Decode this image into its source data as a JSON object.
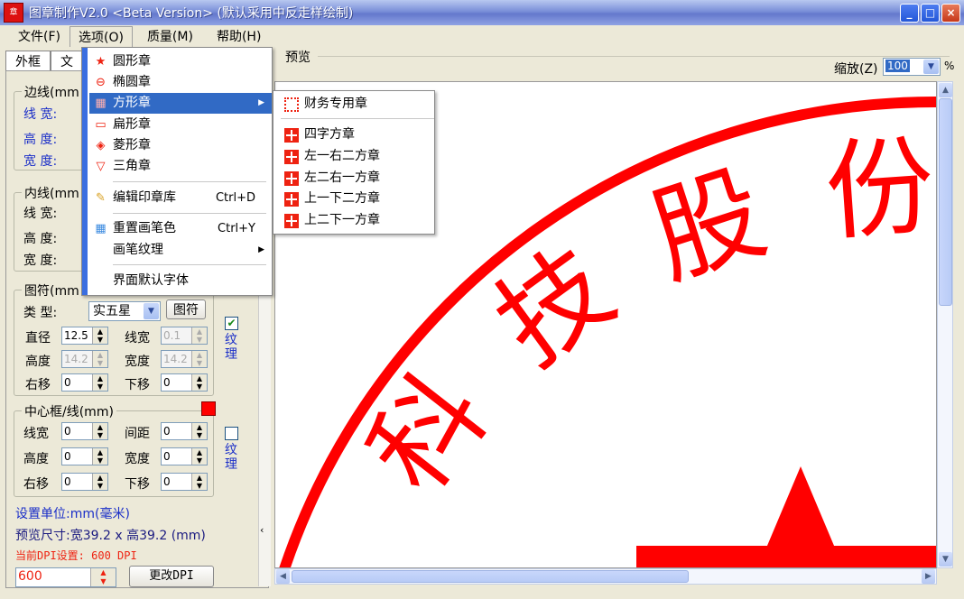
{
  "window": {
    "title": "图章制作V2.0 <Beta Version> (默认采用中反走样绘制)",
    "icon_text": "章",
    "buttons": [
      "_",
      "□",
      "×"
    ]
  },
  "menubar": [
    "文件(F)",
    "选项(O)",
    "质量(M)",
    "帮助(H)"
  ],
  "tabs": [
    "外框",
    "文"
  ],
  "options_menu": {
    "items": [
      {
        "label": "圆形章",
        "icon": "star-circle-icon",
        "glyph": "★"
      },
      {
        "label": "椭圆章",
        "icon": "ellipse-seal-icon",
        "glyph": "⊖"
      },
      {
        "label": "方形章",
        "icon": "square-seal-icon",
        "glyph": "▦",
        "highlight": true,
        "submenu": true
      },
      {
        "label": "扁形章",
        "icon": "flat-seal-icon",
        "glyph": "▭"
      },
      {
        "label": "菱形章",
        "icon": "diamond-seal-icon",
        "glyph": "◈"
      },
      {
        "label": "三角章",
        "icon": "triangle-seal-icon",
        "glyph": "▽"
      }
    ],
    "edit_library": {
      "label": "编辑印章库",
      "shortcut": "Ctrl+D",
      "glyph": "✎"
    },
    "reset_color": {
      "label": "重置画笔色",
      "shortcut": "Ctrl+Y",
      "glyph": "▦"
    },
    "pen_texture": {
      "label": "画笔纹理"
    },
    "default_font": {
      "label": "界面默认字体"
    }
  },
  "square_submenu": [
    "财务专用章",
    "四字方章",
    "左一右二方章",
    "左二右一方章",
    "上一下二方章",
    "上二下一方章"
  ],
  "panel": {
    "border_group": {
      "title": "边线(mm",
      "line_width": "线  宽:",
      "height": "高  度:",
      "width": "宽  度:"
    },
    "inner_group": {
      "title": "内线(mm",
      "line_width": "线  宽:",
      "height": "高  度:",
      "width": "宽  度:"
    },
    "symbol_group": {
      "title": "图符(mm",
      "type_label": "类  型:",
      "type_value": "实五星",
      "symbol_button": "图符",
      "diameter_label": "直径",
      "diameter_value": "12.5",
      "linewidth_label": "线宽",
      "linewidth_value": "0.1",
      "height_label": "高度",
      "height_value": "14.2",
      "width_label": "宽度",
      "width_value": "14.2",
      "right_label": "右移",
      "right_value": "0",
      "down_label": "下移",
      "down_value": "0",
      "texture_label": "纹理",
      "texture_checked": true
    },
    "center_group": {
      "title": "中心框/线(mm)",
      "color": "#ff0000",
      "linewidth_label": "线宽",
      "linewidth_value": "0",
      "spacing_label": "间距",
      "spacing_value": "0",
      "height_label": "高度",
      "height_value": "0",
      "width_label": "宽度",
      "width_value": "0",
      "right_label": "右移",
      "right_value": "0",
      "down_label": "下移",
      "down_value": "0",
      "texture_label": "纹理",
      "texture_checked": false
    },
    "unit_text": "设置单位:mm(毫米)",
    "preview_size_text": "预览尺寸:宽39.2 x 高39.2 (mm)",
    "dpi_text": "当前DPI设置: 600 DPI",
    "dpi_value": "600",
    "change_dpi_button": "更改DPI"
  },
  "preview": {
    "label": "预览",
    "zoom_label": "缩放(Z)",
    "zoom_value": "100",
    "zoom_unit": "%",
    "seal_chars": [
      "科",
      "技",
      "股",
      "份"
    ],
    "seal_color": "#ff0000"
  }
}
